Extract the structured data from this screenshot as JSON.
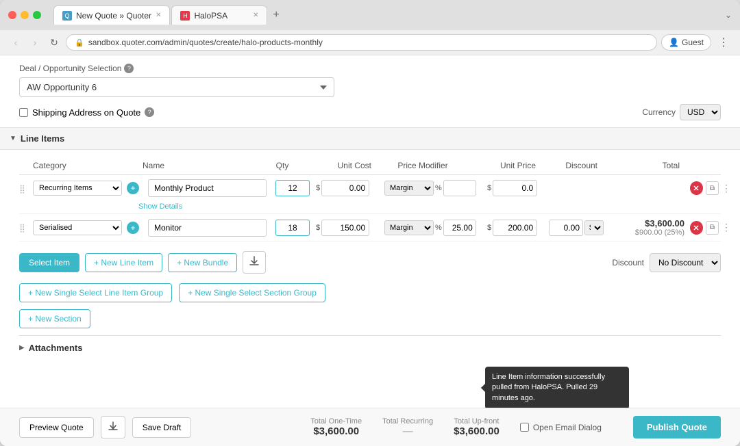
{
  "browser": {
    "tabs": [
      {
        "id": "quoter",
        "label": "New Quote » Quoter",
        "active": true,
        "icon_color": "#4a9cc7"
      },
      {
        "id": "halopsa",
        "label": "HaloPSA",
        "active": false,
        "icon_color": "#e8374a"
      }
    ],
    "address": "sandbox.quoter.com/admin/quotes/create/halo-products-monthly",
    "guest_label": "Guest"
  },
  "page": {
    "deal_section": {
      "label": "Deal / Opportunity Selection",
      "selected_opportunity": "AW Opportunity 6",
      "shipping_label": "Shipping Address on Quote",
      "currency_label": "Currency",
      "currency_value": "USD"
    },
    "line_items": {
      "section_title": "Line Items",
      "columns": [
        "Category",
        "Name",
        "Qty",
        "Unit Cost",
        "Price Modifier",
        "Unit Price",
        "Discount",
        "Total"
      ],
      "rows": [
        {
          "id": "row1",
          "category": "Recurring Items",
          "name": "Monthly Product",
          "qty": "12",
          "unit_cost": "0.00",
          "price_modifier": "Margin",
          "price_modifier_pct": "",
          "price_modifier_val": "",
          "unit_price": "0.0",
          "discount": "",
          "total": "",
          "show_details": "Show Details",
          "has_tooltip": true
        },
        {
          "id": "row2",
          "category": "Serialised",
          "name": "Monitor",
          "qty": "18",
          "unit_cost": "150.00",
          "price_modifier": "Margin",
          "price_modifier_pct": "%",
          "price_modifier_val": "25.00",
          "unit_price": "200.00",
          "discount": "0.00",
          "total": "$3,600.00",
          "total_sub": "$900.00 (25%)",
          "has_tooltip": false
        }
      ],
      "tooltip": {
        "text": "Line Item information successfully pulled from HaloPSA. Pulled 29 minutes ago."
      },
      "toolbar": {
        "select_item": "Select Item",
        "new_line_item": "+ New Line Item",
        "new_bundle": "+ New Bundle",
        "discount_label": "Discount",
        "discount_option": "No Discount"
      },
      "groups": {
        "single_select_line": "+ New Single Select Line Item Group",
        "single_select_section": "+ New Single Select Section Group"
      },
      "new_section": "+ New Section"
    },
    "attachments": {
      "title": "Attachments"
    },
    "footer": {
      "preview_label": "Preview Quote",
      "save_draft_label": "Save Draft",
      "total_one_time_label": "Total One-Time",
      "total_one_time_val": "$3,600.00",
      "total_recurring_label": "Total Recurring",
      "total_recurring_val": "—",
      "total_upfront_label": "Total Up-front",
      "total_upfront_val": "$3,600.00",
      "open_email_label": "Open Email Dialog",
      "publish_label": "Publish Quote"
    }
  }
}
